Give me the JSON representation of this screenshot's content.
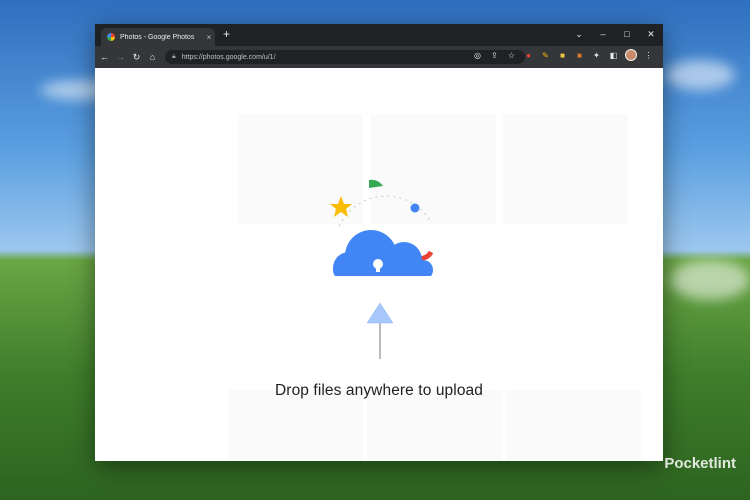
{
  "browser": {
    "tab_title": "Photos - Google Photos",
    "url": "https://photos.google.com/u/1/",
    "tab_close": "×",
    "new_tab": "+",
    "window_controls": {
      "chevron": "⌄",
      "minimize": "–",
      "maximize": "□",
      "close": "✕"
    }
  },
  "nav": {
    "back": "←",
    "forward": "→",
    "reload": "↻",
    "home": "⌂"
  },
  "overlay": {
    "drop_text": "Drop files anywhere to upload"
  },
  "watermark": {
    "text": "Pocketlint"
  },
  "colors": {
    "cloud": "#4285f4",
    "green": "#34a853",
    "yellow": "#fbbc04",
    "red": "#ea4335"
  }
}
